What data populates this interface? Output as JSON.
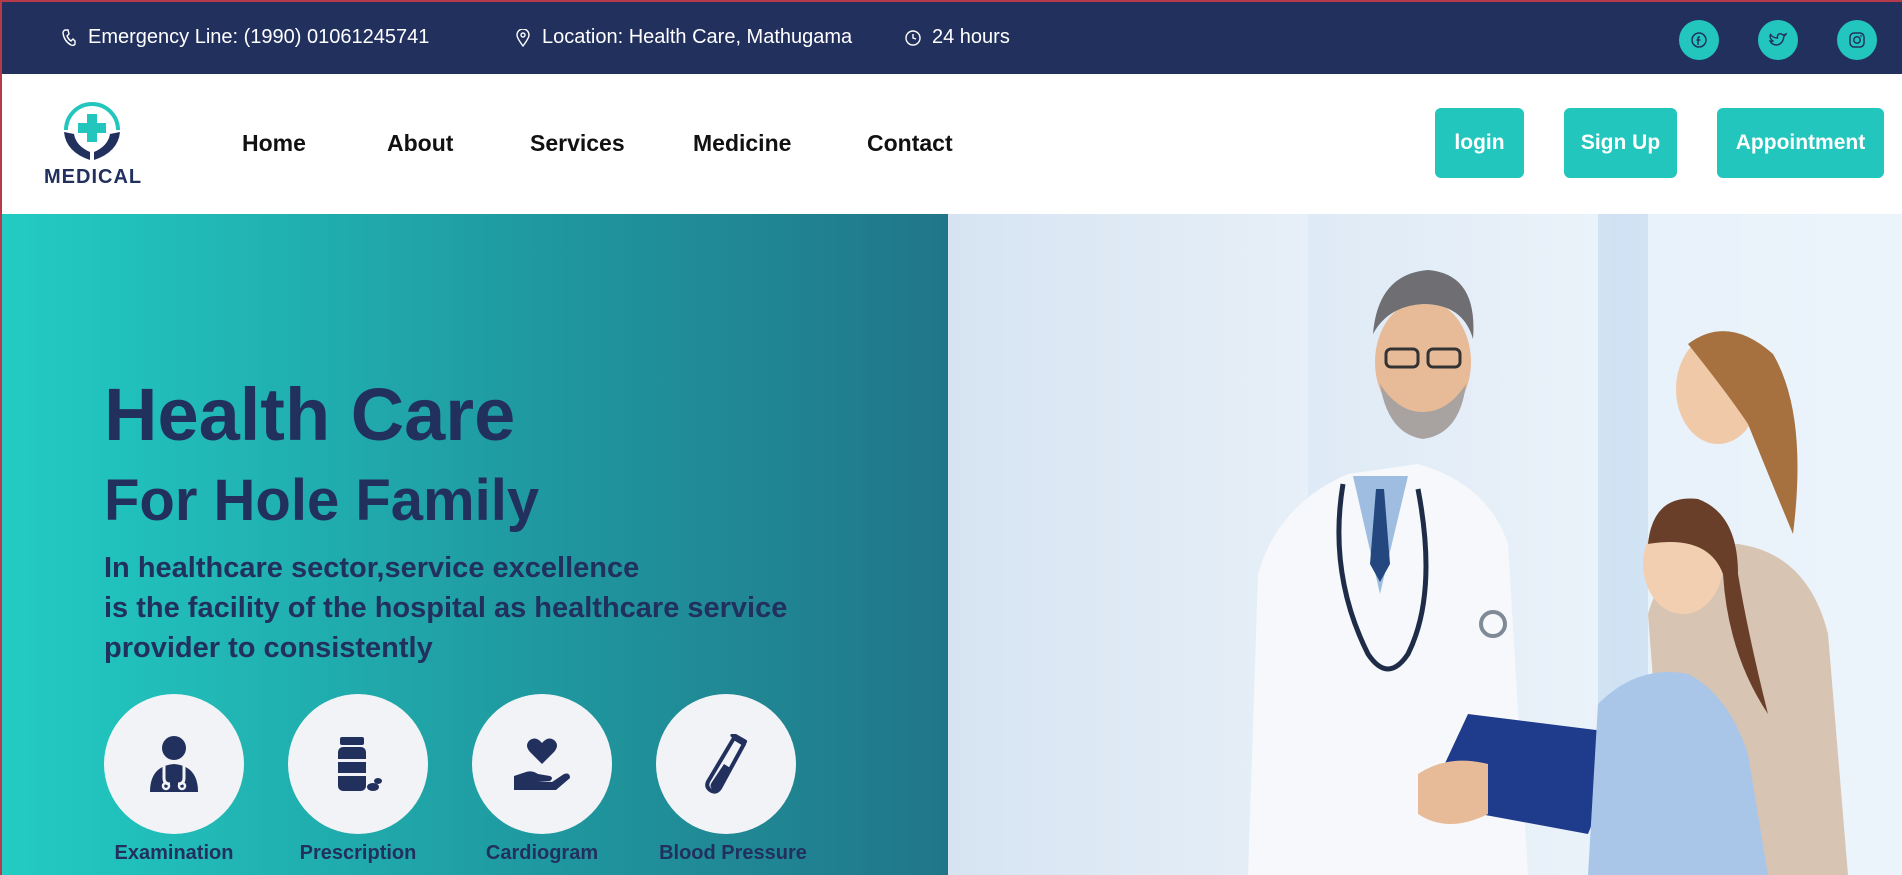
{
  "topbar": {
    "emergency": "Emergency Line: (1990) 01061245741",
    "location": "Location: Health Care, Mathugama",
    "hours": "24 hours",
    "icons": [
      "phone-icon",
      "location-pin-icon",
      "clock-icon",
      "facebook-icon",
      "twitter-icon",
      "instagram-icon"
    ]
  },
  "logo": {
    "text": "MEDICAL"
  },
  "nav": {
    "links": [
      "Home",
      "About",
      "Services",
      "Medicine",
      "Contact"
    ]
  },
  "buttons": {
    "login": "login",
    "signup": "Sign Up",
    "appointment": "Appointment"
  },
  "hero": {
    "title": "Health Care",
    "subtitle": "For Hole Family",
    "desc_lines": [
      "In healthcare sector,service excellence",
      "is the facility of the hospital as healthcare service",
      "provider to consistently"
    ],
    "services": [
      {
        "label": "Examination",
        "icon": "doctor-icon"
      },
      {
        "label": "Prescription",
        "icon": "pill-bottle-icon"
      },
      {
        "label": "Cardiogram",
        "icon": "heart-hand-icon"
      },
      {
        "label": "Blood Pressure",
        "icon": "test-tube-icon"
      }
    ]
  },
  "colors": {
    "navy": "#22305e",
    "teal": "#22c6bd",
    "white": "#ffffff"
  }
}
